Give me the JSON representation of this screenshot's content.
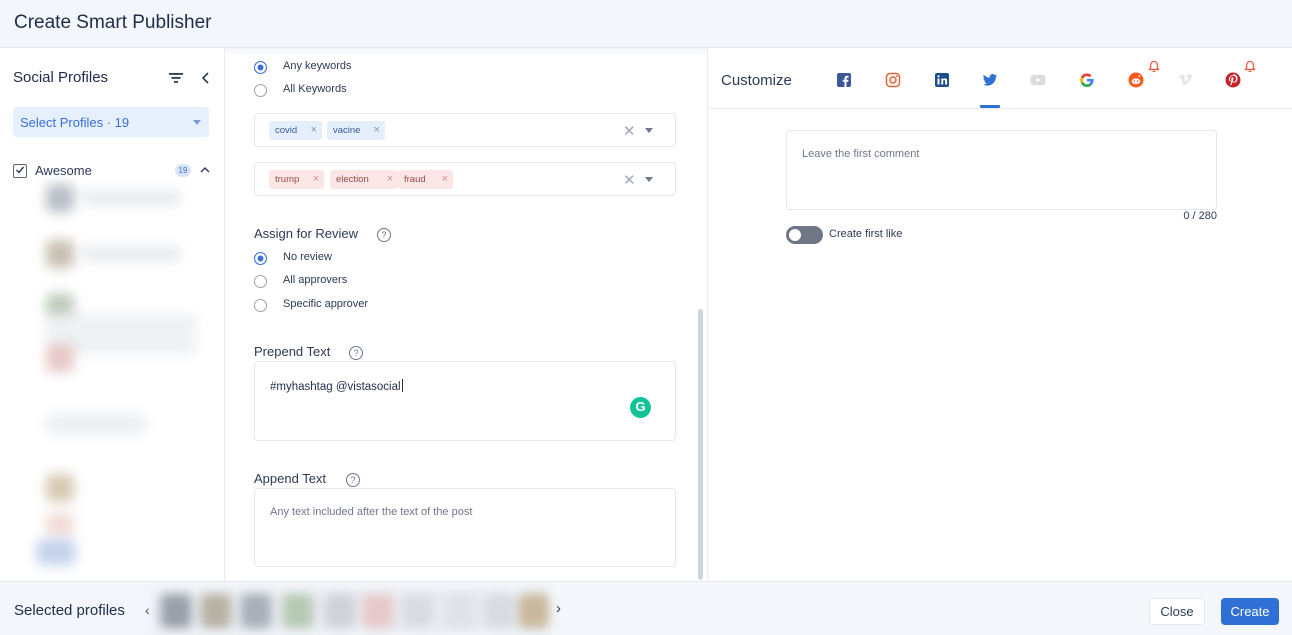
{
  "header": {
    "title": "Create Smart Publisher"
  },
  "left": {
    "title": "Social Profiles",
    "select_label": "Select Profiles · 19",
    "group": {
      "name": "Awesome",
      "count": "19",
      "checked": true
    }
  },
  "middle": {
    "keyword_mode": [
      {
        "label": "Any keywords",
        "selected": true
      },
      {
        "label": "All Keywords",
        "selected": false
      }
    ],
    "include_tags": [
      "covid",
      "vacine"
    ],
    "exclude_tags": [
      "trump",
      "election",
      "fraud"
    ],
    "review": {
      "label": "Assign for Review",
      "options": [
        {
          "label": "No review",
          "selected": true
        },
        {
          "label": "All approvers",
          "selected": false
        },
        {
          "label": "Specific approver",
          "selected": false
        }
      ]
    },
    "prepend": {
      "label": "Prepend Text",
      "value": "#myhashtag @vistasocial"
    },
    "append": {
      "label": "Append Text",
      "placeholder": "Any text included after the text of the post"
    },
    "help_glyph": "?"
  },
  "right": {
    "title": "Customize",
    "networks": [
      "facebook-icon",
      "instagram-icon",
      "linkedin-icon",
      "twitter-icon",
      "youtube-icon",
      "google-icon",
      "reddit-icon",
      "vimeo-icon",
      "pinterest-icon"
    ],
    "active_network": "twitter-icon",
    "comment_placeholder": "Leave the first comment",
    "counter": "0 / 280",
    "toggle_label": "Create first like",
    "toggle_on": false
  },
  "footer": {
    "selected_label": "Selected profiles",
    "close_label": "Close",
    "create_label": "Create"
  },
  "colors": {
    "accent": "#2f6fd6",
    "tag_blue": "#e5eefb",
    "tag_red": "#fbe6e6",
    "grammarly": "#15c39a"
  }
}
